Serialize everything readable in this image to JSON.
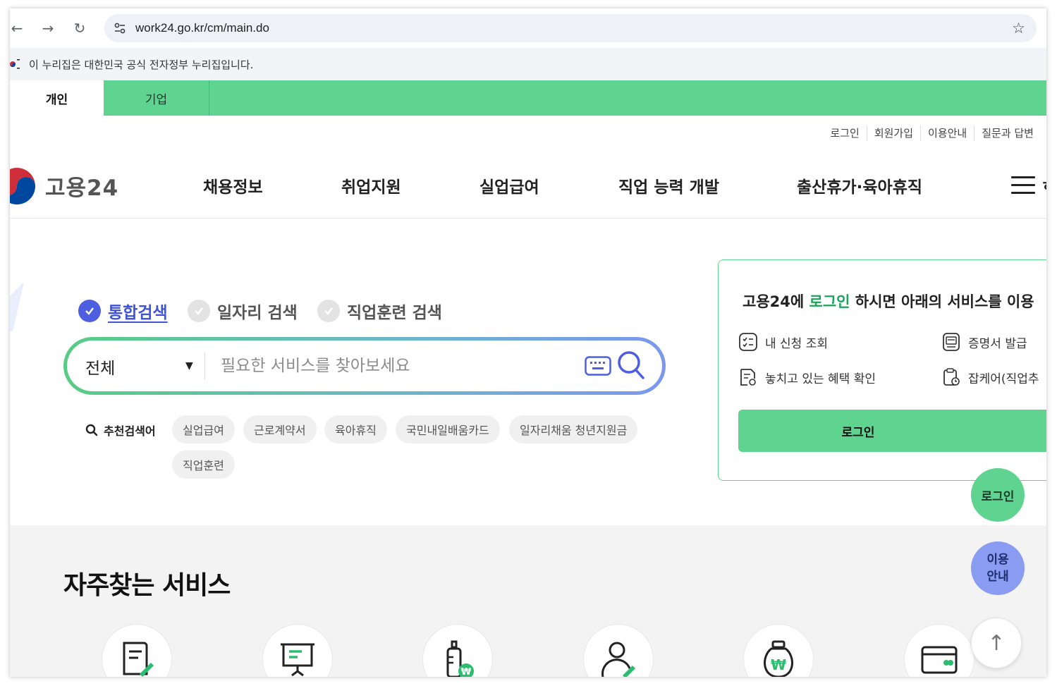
{
  "browser": {
    "url": "work24.go.kr/cm/main.do"
  },
  "gov_banner": {
    "text": "이 누리집은 대한민국 공식 전자정부 누리집입니다."
  },
  "top_tabs": [
    {
      "label": "개인",
      "active": true
    },
    {
      "label": "기업",
      "active": false
    }
  ],
  "utility_links": [
    "로그인",
    "회원가입",
    "이용안내",
    "질문과 답변"
  ],
  "logo": {
    "text": "고용24"
  },
  "gnb": [
    "채용정보",
    "취업지원",
    "실업급여",
    "직업 능력 개발",
    "출산휴가·육아휴직"
  ],
  "gnb_cut_char": "ㅎ",
  "search": {
    "tabs": [
      {
        "label": "통합검색",
        "active": true
      },
      {
        "label": "일자리 검색",
        "active": false
      },
      {
        "label": "직업훈련 검색",
        "active": false
      }
    ],
    "select_value": "전체",
    "placeholder": "필요한 서비스를 찾아보세요",
    "recommended_title": "추천검색어",
    "recommended": [
      "실업급여",
      "근로계약서",
      "육아휴직",
      "국민내일배움카드",
      "일자리채움 청년지원금",
      "직업훈련"
    ]
  },
  "login_panel": {
    "title_prefix": "고용24에 ",
    "title_highlight": "로그인",
    "title_suffix": " 하시면 아래의 서비스를 이용",
    "items": [
      "내 신청 조회",
      "증명서 발급",
      "놓치고 있는 혜택 확인",
      "잡케어(직업추"
    ],
    "button": "로그인"
  },
  "floating": {
    "login": "로그인",
    "guide_line1": "이용",
    "guide_line2": "안내",
    "top": "↑"
  },
  "services": {
    "title": "자주찾는 서비스",
    "icons": [
      "document-edit-icon",
      "presentation-board-icon",
      "baby-bottle-icon",
      "user-edit-icon",
      "money-bag-icon",
      "card-icon"
    ]
  },
  "colors": {
    "brand_green": "#5fd490",
    "accent_blue": "#4d5ee0",
    "guide_purple": "#8a9cf2"
  }
}
